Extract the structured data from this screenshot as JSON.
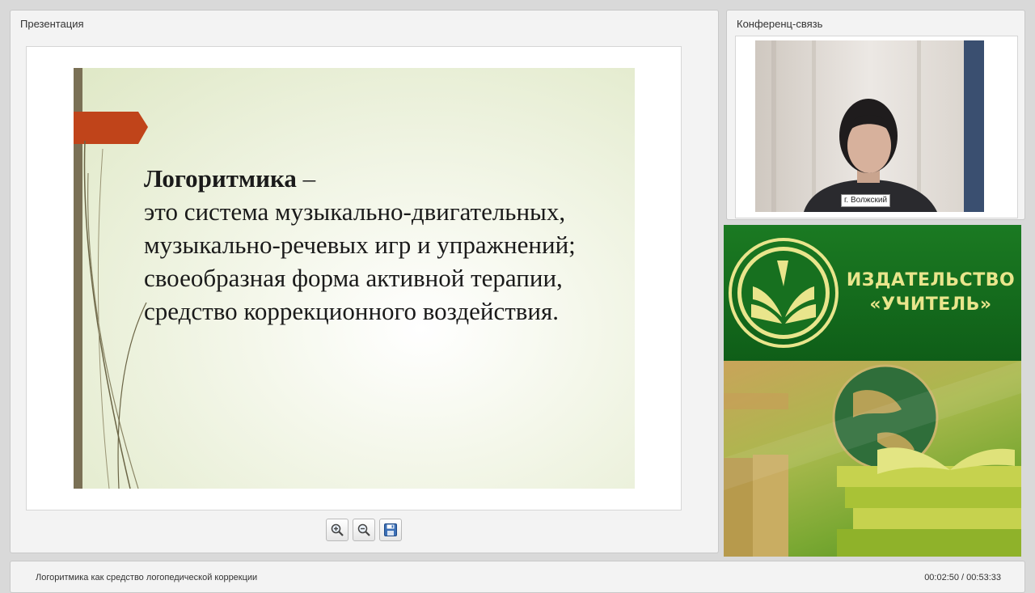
{
  "presentation": {
    "panel_title": "Презентация"
  },
  "slide": {
    "heading": "Логоритмика",
    "heading_suffix": " –",
    "lines": [
      "это система музыкально-двигательных,",
      "музыкально-речевых игр и упражнений;",
      "своеобразная форма активной терапии,",
      "средство коррекционного воздействия."
    ]
  },
  "toolbar": {
    "zoom_in": "zoom-in-icon",
    "zoom_out": "zoom-out-icon",
    "save": "save-icon"
  },
  "conference": {
    "panel_title": "Конференц-связь",
    "participant_label": "г. Волжский"
  },
  "ad": {
    "name_line1": "ИЗДАТЕЛЬСТВО",
    "name_line2": "«УЧИТЕЛЬ»"
  },
  "footer": {
    "title": "Логоритмика как средство логопедической коррекции",
    "time": "00:02:50 / 00:53:33"
  },
  "colors": {
    "slide_bar": "#7a7055",
    "slide_arrow": "#c0441a",
    "ad_green": "#166b1d",
    "ad_text": "#e9e58c"
  }
}
